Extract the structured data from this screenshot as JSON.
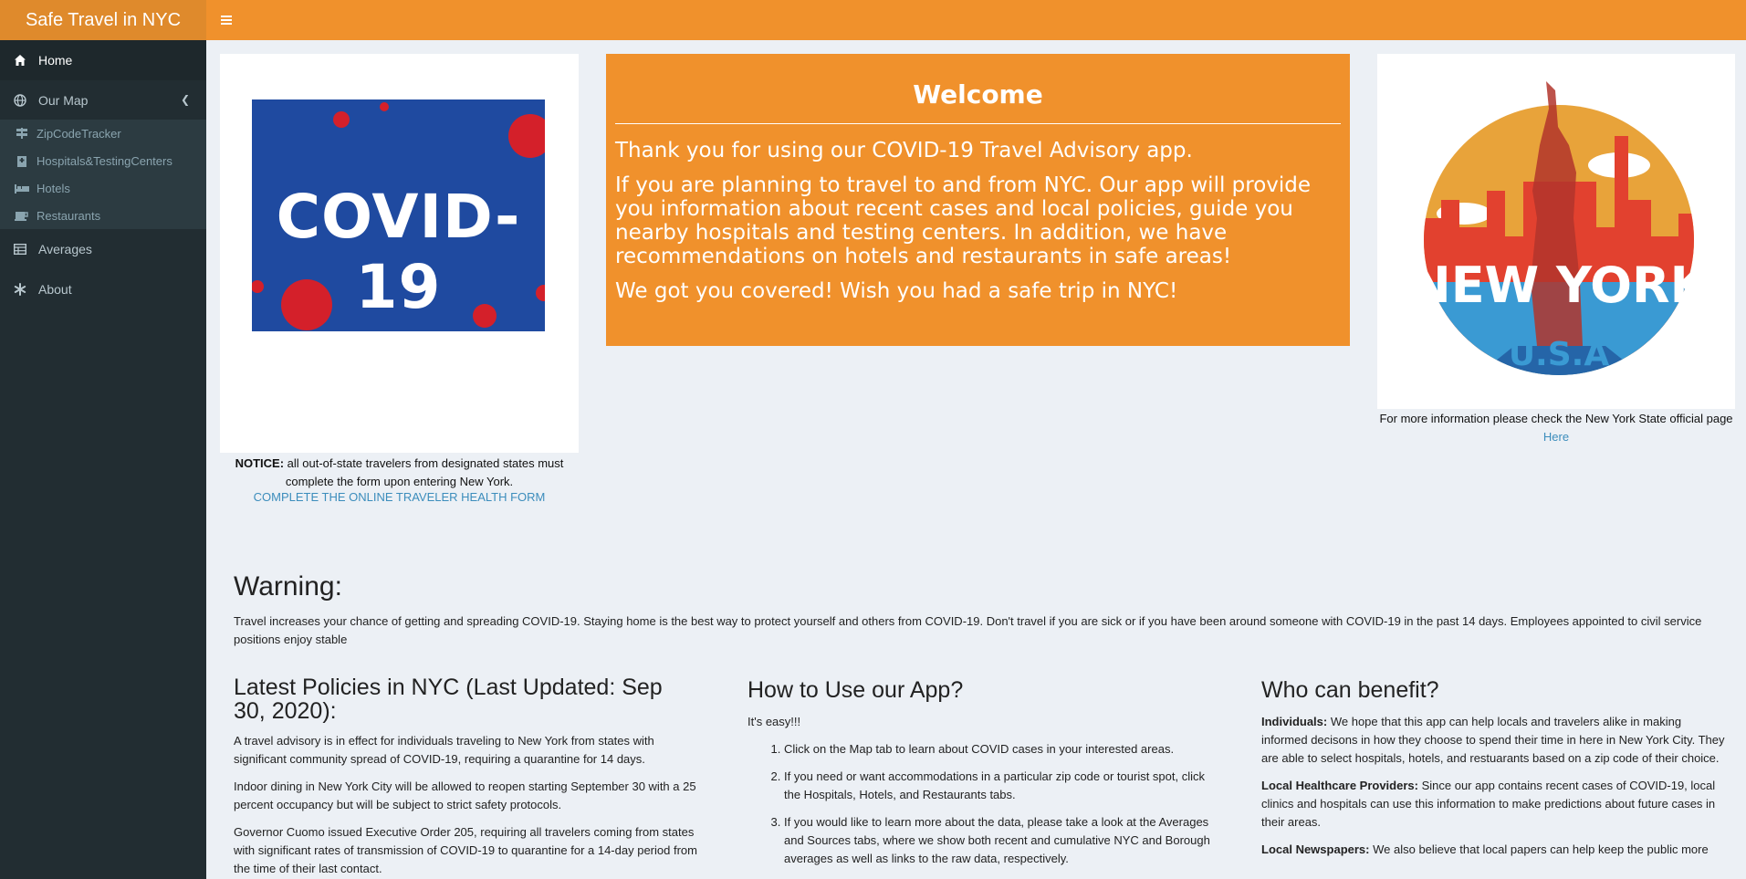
{
  "app": {
    "title": "Safe Travel in NYC"
  },
  "sidebar": {
    "items": [
      {
        "label": "Home",
        "icon": "home-icon"
      },
      {
        "label": "Our Map",
        "icon": "globe-icon"
      },
      {
        "label": "Averages",
        "icon": "table-icon"
      },
      {
        "label": "About",
        "icon": "asterisk-icon"
      }
    ],
    "submenu": [
      {
        "label": "ZipCodeTracker",
        "icon": "signs-icon"
      },
      {
        "label": "Hospitals&TestingCenters",
        "icon": "hospital-icon"
      },
      {
        "label": "Hotels",
        "icon": "bed-icon"
      },
      {
        "label": "Restaurants",
        "icon": "coffee-icon"
      }
    ]
  },
  "left": {
    "image_text": "COVID-19",
    "notice_label": "NOTICE:",
    "notice_text": " all out-of-state travelers from designated states must complete the form upon entering New York.",
    "form_link": "COMPLETE THE ONLINE TRAVELER HEALTH FORM"
  },
  "welcome": {
    "title": "Welcome",
    "p1": "Thank you for using our COVID-19 Travel Advisory app.",
    "p2": "If you are planning to travel to and from NYC. Our app will provide you information about recent cases and local policies, guide you nearby hospitals and testing centers. In addition, we have recommendations on hotels and restaurants in safe areas!",
    "p3": "We got you covered! Wish you had a safe trip in NYC!"
  },
  "right": {
    "logo_text": "NEW YORK",
    "logo_sub": "U.S.A",
    "caption": "For more information please check the New York State official page",
    "link": "Here"
  },
  "warning": {
    "title": "Warning:",
    "text": "Travel increases your chance of getting and spreading COVID-19. Staying home is the best way to protect yourself and others from COVID-19. Don't travel if you are sick or if you have been around someone with COVID-19 in the past 14 days. Employees appointed to civil service positions enjoy stable"
  },
  "policies": {
    "title": "Latest Policies in NYC (Last Updated: Sep 30, 2020):",
    "p1": "A travel advisory is in effect for individuals traveling to New York from states with significant community spread of COVID-19, requiring a quarantine for 14 days.",
    "p2": "Indoor dining in New York City will be allowed to reopen starting September 30 with a 25 percent occupancy but will be subject to strict safety protocols.",
    "p3": "Governor Cuomo issued Executive Order 205, requiring all travelers coming from states with significant rates of transmission of COVID-19 to quarantine for a 14-day period from the time of their last contact."
  },
  "howto": {
    "title": "How to Use our App?",
    "intro": "It's easy!!!",
    "steps": [
      "Click on the Map tab to learn about COVID cases in your interested areas.",
      "If you need or want accommodations in a particular zip code or tourist spot, click the Hospitals, Hotels, and Restaurants tabs.",
      "If you would like to learn more about the data, please take a look at the Averages and Sources tabs, where we show both recent and cumulative NYC and Borough averages as well as links to the raw data, respectively."
    ]
  },
  "benefit": {
    "title": "Who can benefit?",
    "items": [
      {
        "label": "Individuals:",
        "text": " We hope that this app can help locals and travelers alike in making informed decisons in how they choose to spend their time in here in New York City. They are able to select hospitals, hotels, and restuarants based on a zip code of their choice."
      },
      {
        "label": "Local Healthcare Providers:",
        "text": " Since our app contains recent cases of COVID-19, local clinics and hospitals can use this information to make predictions about future cases in their areas."
      },
      {
        "label": "Local Newspapers:",
        "text": " We also believe that local papers can help keep the public more"
      }
    ]
  },
  "colors": {
    "accent": "#f0912c",
    "sidebar": "#222d32",
    "link": "#3c8dbc"
  }
}
